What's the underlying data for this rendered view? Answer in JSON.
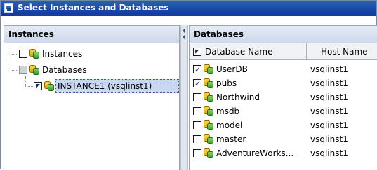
{
  "window": {
    "title": "Select Instances and Databases"
  },
  "left_pane": {
    "header": "Instances",
    "tree": [
      {
        "label": "Instances",
        "checkbox": "unchecked",
        "level": 0
      },
      {
        "label": "Databases",
        "checkbox": "disabled",
        "level": 0
      },
      {
        "label": "INSTANCE1 (vsqlinst1)",
        "checkbox": "partial",
        "level": 1,
        "selected": true
      }
    ]
  },
  "right_pane": {
    "header": "Databases",
    "columns": [
      "Database Name",
      "Host Name"
    ],
    "header_checkbox": "partial",
    "rows": [
      {
        "name": "UserDB",
        "host": "vsqlinst1",
        "checked": true
      },
      {
        "name": "pubs",
        "host": "vsqlinst1",
        "checked": true
      },
      {
        "name": "Northwind",
        "host": "vsqlinst1",
        "checked": false
      },
      {
        "name": "msdb",
        "host": "vsqlinst1",
        "checked": false
      },
      {
        "name": "model",
        "host": "vsqlinst1",
        "checked": false
      },
      {
        "name": "master",
        "host": "vsqlinst1",
        "checked": false
      },
      {
        "name": "AdventureWorks...",
        "host": "vsqlinst1",
        "checked": false
      }
    ]
  },
  "icons": {
    "window": "window-icon",
    "database": "database-icon"
  },
  "colors": {
    "titlebar": "#0a3c9c",
    "selection": "#c9d7f2",
    "pane_header": "#cdd8ea"
  }
}
